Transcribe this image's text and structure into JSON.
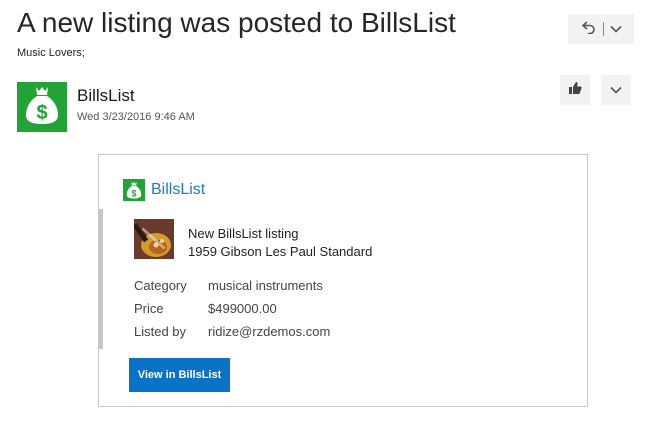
{
  "email": {
    "subject": "A new listing was posted to BillsList",
    "recipients": "Music Lovers;",
    "sender": {
      "name": "BillsList",
      "date": "Wed 3/23/2016 9:46 AM"
    }
  },
  "toolbar": {
    "reply_icon": "reply-icon",
    "dropdown_icon": "chevron-down-icon",
    "like_icon": "like-icon",
    "more_icon": "chevron-down-icon"
  },
  "card": {
    "brand": "BillsList",
    "listing_header": "New BillsList listing",
    "listing_name": "1959 Gibson Les Paul Standard",
    "facts": [
      {
        "label": "Category",
        "value": "musical instruments"
      },
      {
        "label": "Price",
        "value": "$499000.00"
      },
      {
        "label": "Listed by",
        "value": "ridize@rzdemos.com"
      }
    ],
    "button_label": "View in BillsList"
  },
  "colors": {
    "brand_green": "#21a336",
    "link_blue": "#1e7bc4",
    "button_blue": "#0a72c7"
  }
}
